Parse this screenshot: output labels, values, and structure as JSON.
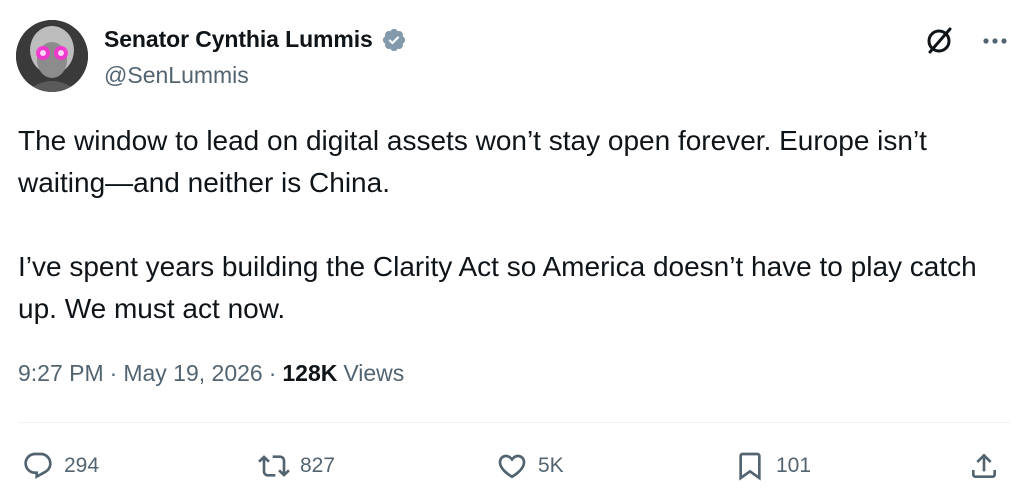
{
  "author": {
    "display_name": "Senator Cynthia Lummis",
    "handle": "@SenLummis",
    "verified": true,
    "verified_color": "#829aab"
  },
  "tweet": {
    "paragraph1": "The window to lead on digital assets won’t stay open forever. Europe isn’t waiting—and neither is China.",
    "paragraph2": "I’ve spent years building the Clarity Act so America doesn’t have to play catch up. We must act now."
  },
  "meta": {
    "time": "9:27 PM",
    "separator": "·",
    "date": "May 19, 2026",
    "views_count": "128K",
    "views_label": "Views"
  },
  "actions": {
    "replies": "294",
    "reposts": "827",
    "likes": "5K",
    "bookmarks": "101"
  },
  "icons": {
    "top": [
      "grok-icon",
      "more-icon"
    ],
    "actions": [
      "reply-icon",
      "repost-icon",
      "like-icon",
      "bookmark-icon",
      "share-icon"
    ]
  },
  "colors": {
    "text": "#0f1419",
    "secondary": "#536471",
    "divider": "#eff3f4",
    "avatar_accent": "#ff2bd6"
  }
}
